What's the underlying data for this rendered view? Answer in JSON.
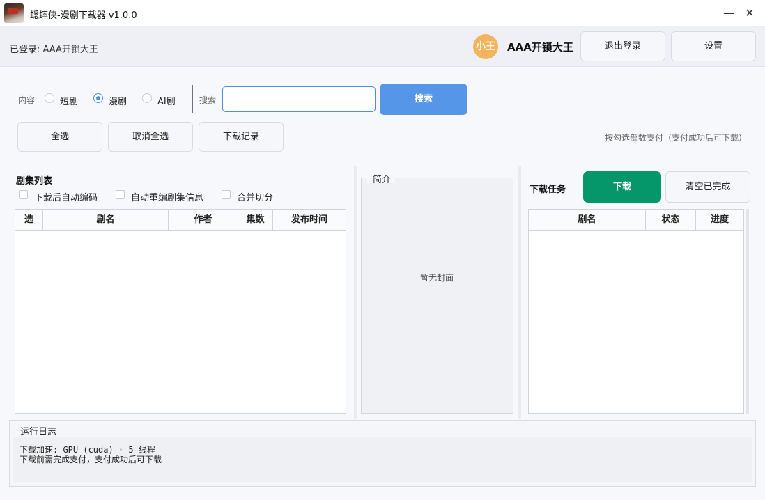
{
  "window": {
    "title": "蟋蟀侠-漫剧下载器 v1.0.0",
    "minimize_glyph": "—",
    "close_glyph": "✕"
  },
  "header": {
    "login_status": "已登录: AAA开锁大王",
    "avatar_text": "小王",
    "username": "AAA开锁大王",
    "logout_label": "退出登录",
    "settings_label": "设置"
  },
  "filters": {
    "content_label": "内容",
    "options": [
      "短剧",
      "漫剧",
      "AI剧"
    ],
    "selected": "漫剧",
    "search_label": "搜索",
    "search_value": "",
    "search_button": "搜索"
  },
  "actions": {
    "select_all": "全选",
    "deselect_all": "取消全选",
    "history": "下载记录",
    "pay_hint": "按勾选部数支付（支付成功后可下载）"
  },
  "episode_list": {
    "title": "剧集列表",
    "options": [
      {
        "label": "下载后自动编码",
        "checked": false
      },
      {
        "label": "自动重编剧集信息",
        "checked": false
      },
      {
        "label": "合并切分",
        "checked": false
      }
    ],
    "columns": [
      "选",
      "剧名",
      "作者",
      "集数",
      "发布时间"
    ],
    "rows": []
  },
  "intro": {
    "title": "简介",
    "no_cover": "暂无封面"
  },
  "download": {
    "title": "下载任务",
    "download_button": "下载",
    "clear_button": "清空已完成",
    "columns": [
      "剧名",
      "状态",
      "进度"
    ],
    "rows": []
  },
  "log": {
    "title": "运行日志",
    "lines": [
      "下载加速: GPU (cuda) · 5 线程",
      "下载前需完成支付，支付成功后可下载"
    ]
  },
  "colors": {
    "accent_blue": "#5596e8",
    "download_green": "#059669",
    "avatar_orange": "#f2b45c"
  }
}
